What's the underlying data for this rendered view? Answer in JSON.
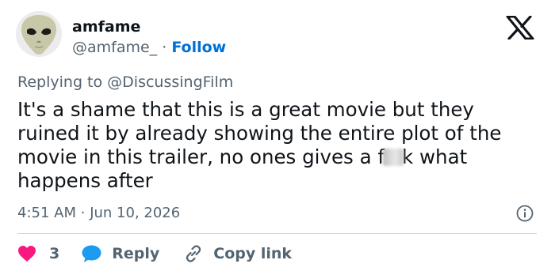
{
  "user": {
    "name": "amfame",
    "handle": "@amfame_",
    "separator": "·",
    "follow_label": "Follow"
  },
  "reply_to": {
    "prefix": "Replying to ",
    "handle": "@DiscussingFilm"
  },
  "tweet": {
    "lines": [
      "It's a shame that this is a great movie but they",
      "ruined it by already showing the entire plot of the",
      "movie in this trailer, no ones gives a f",
      "happens after"
    ],
    "line3_after_blur": "k what"
  },
  "meta": {
    "time": "4:51 AM",
    "separator": "·",
    "date": "Jun 10, 2026"
  },
  "actions": {
    "likes": "3",
    "reply_label": "Reply",
    "copy_label": "Copy link"
  },
  "colors": {
    "like": "#f91880",
    "reply": "#1d9bf0",
    "link": "#006fd6",
    "muted": "#536471",
    "text": "#0f1419"
  },
  "icons": [
    "alien-avatar",
    "x-logo-icon",
    "info-icon",
    "heart-icon",
    "reply-bubble-icon",
    "link-icon"
  ]
}
